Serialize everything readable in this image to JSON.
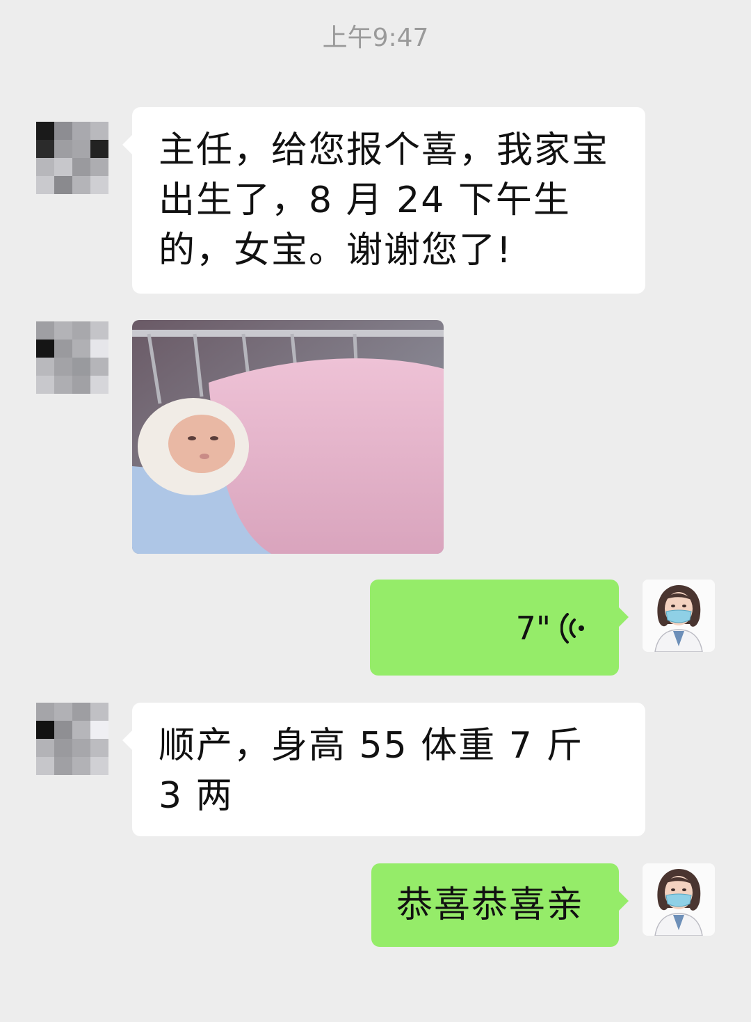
{
  "timestamp": "上午9:47",
  "messages": [
    {
      "side": "in",
      "type": "text",
      "text": "主任，给您报个喜，我家宝出生了，8 月 24 下午生的，女宝。谢谢您了!"
    },
    {
      "side": "in",
      "type": "image",
      "image_desc": "newborn-in-pink-blanket"
    },
    {
      "side": "out",
      "type": "voice",
      "duration": "7\"",
      "icon": "voice-wave-icon"
    },
    {
      "side": "in",
      "type": "text",
      "text": "顺产，身高 55 体重 7 斤 3 两"
    },
    {
      "side": "out",
      "type": "text",
      "text": "恭喜恭喜亲"
    }
  ],
  "colors": {
    "background": "#ededed",
    "incoming_bubble": "#ffffff",
    "outgoing_bubble": "#95ec69",
    "timestamp": "#9a9a9a"
  }
}
